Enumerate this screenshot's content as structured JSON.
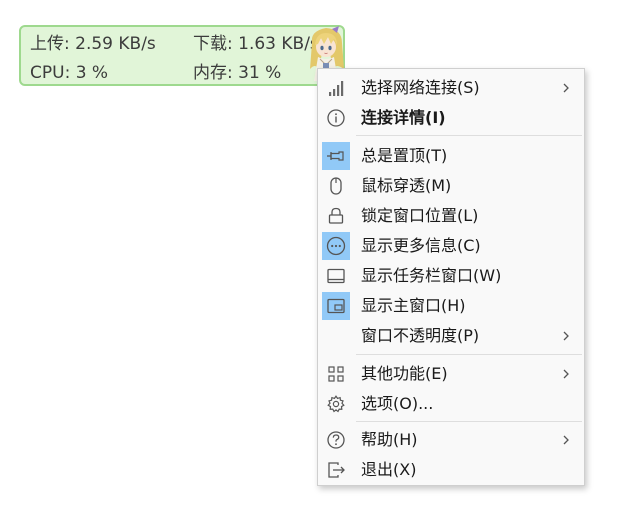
{
  "widget": {
    "upload_label": "上传: 2.59 KB/s",
    "download_label": "下载: 1.63 KB/s",
    "cpu_label": "CPU: 3 %",
    "memory_label": "内存: 31 %"
  },
  "menu": {
    "items": [
      {
        "label": "选择网络连接(S)",
        "icon": "signal-bars-icon",
        "submenu": true
      },
      {
        "label": "连接详情(I)",
        "icon": "info-icon",
        "bold": true
      },
      {
        "label": "总是置顶(T)",
        "icon": "pin-icon",
        "checked": true
      },
      {
        "label": "鼠标穿透(M)",
        "icon": "mouse-icon"
      },
      {
        "label": "锁定窗口位置(L)",
        "icon": "lock-icon"
      },
      {
        "label": "显示更多信息(C)",
        "icon": "more-icon",
        "checked": true
      },
      {
        "label": "显示任务栏窗口(W)",
        "icon": "taskbar-icon"
      },
      {
        "label": "显示主窗口(H)",
        "icon": "main-window-icon",
        "checked": true
      },
      {
        "label": "窗口不透明度(P)",
        "icon": "",
        "submenu": true
      },
      {
        "label": "其他功能(E)",
        "icon": "grid-icon",
        "submenu": true
      },
      {
        "label": "选项(O)...",
        "icon": "gear-icon"
      },
      {
        "label": "帮助(H)",
        "icon": "help-icon",
        "submenu": true
      },
      {
        "label": "退出(X)",
        "icon": "exit-icon"
      }
    ]
  },
  "colors": {
    "widget_background": "#e1f5d8",
    "widget_border": "#9ed98e",
    "checked_highlight": "#91c9f7",
    "menu_background": "#f9f9f9"
  }
}
